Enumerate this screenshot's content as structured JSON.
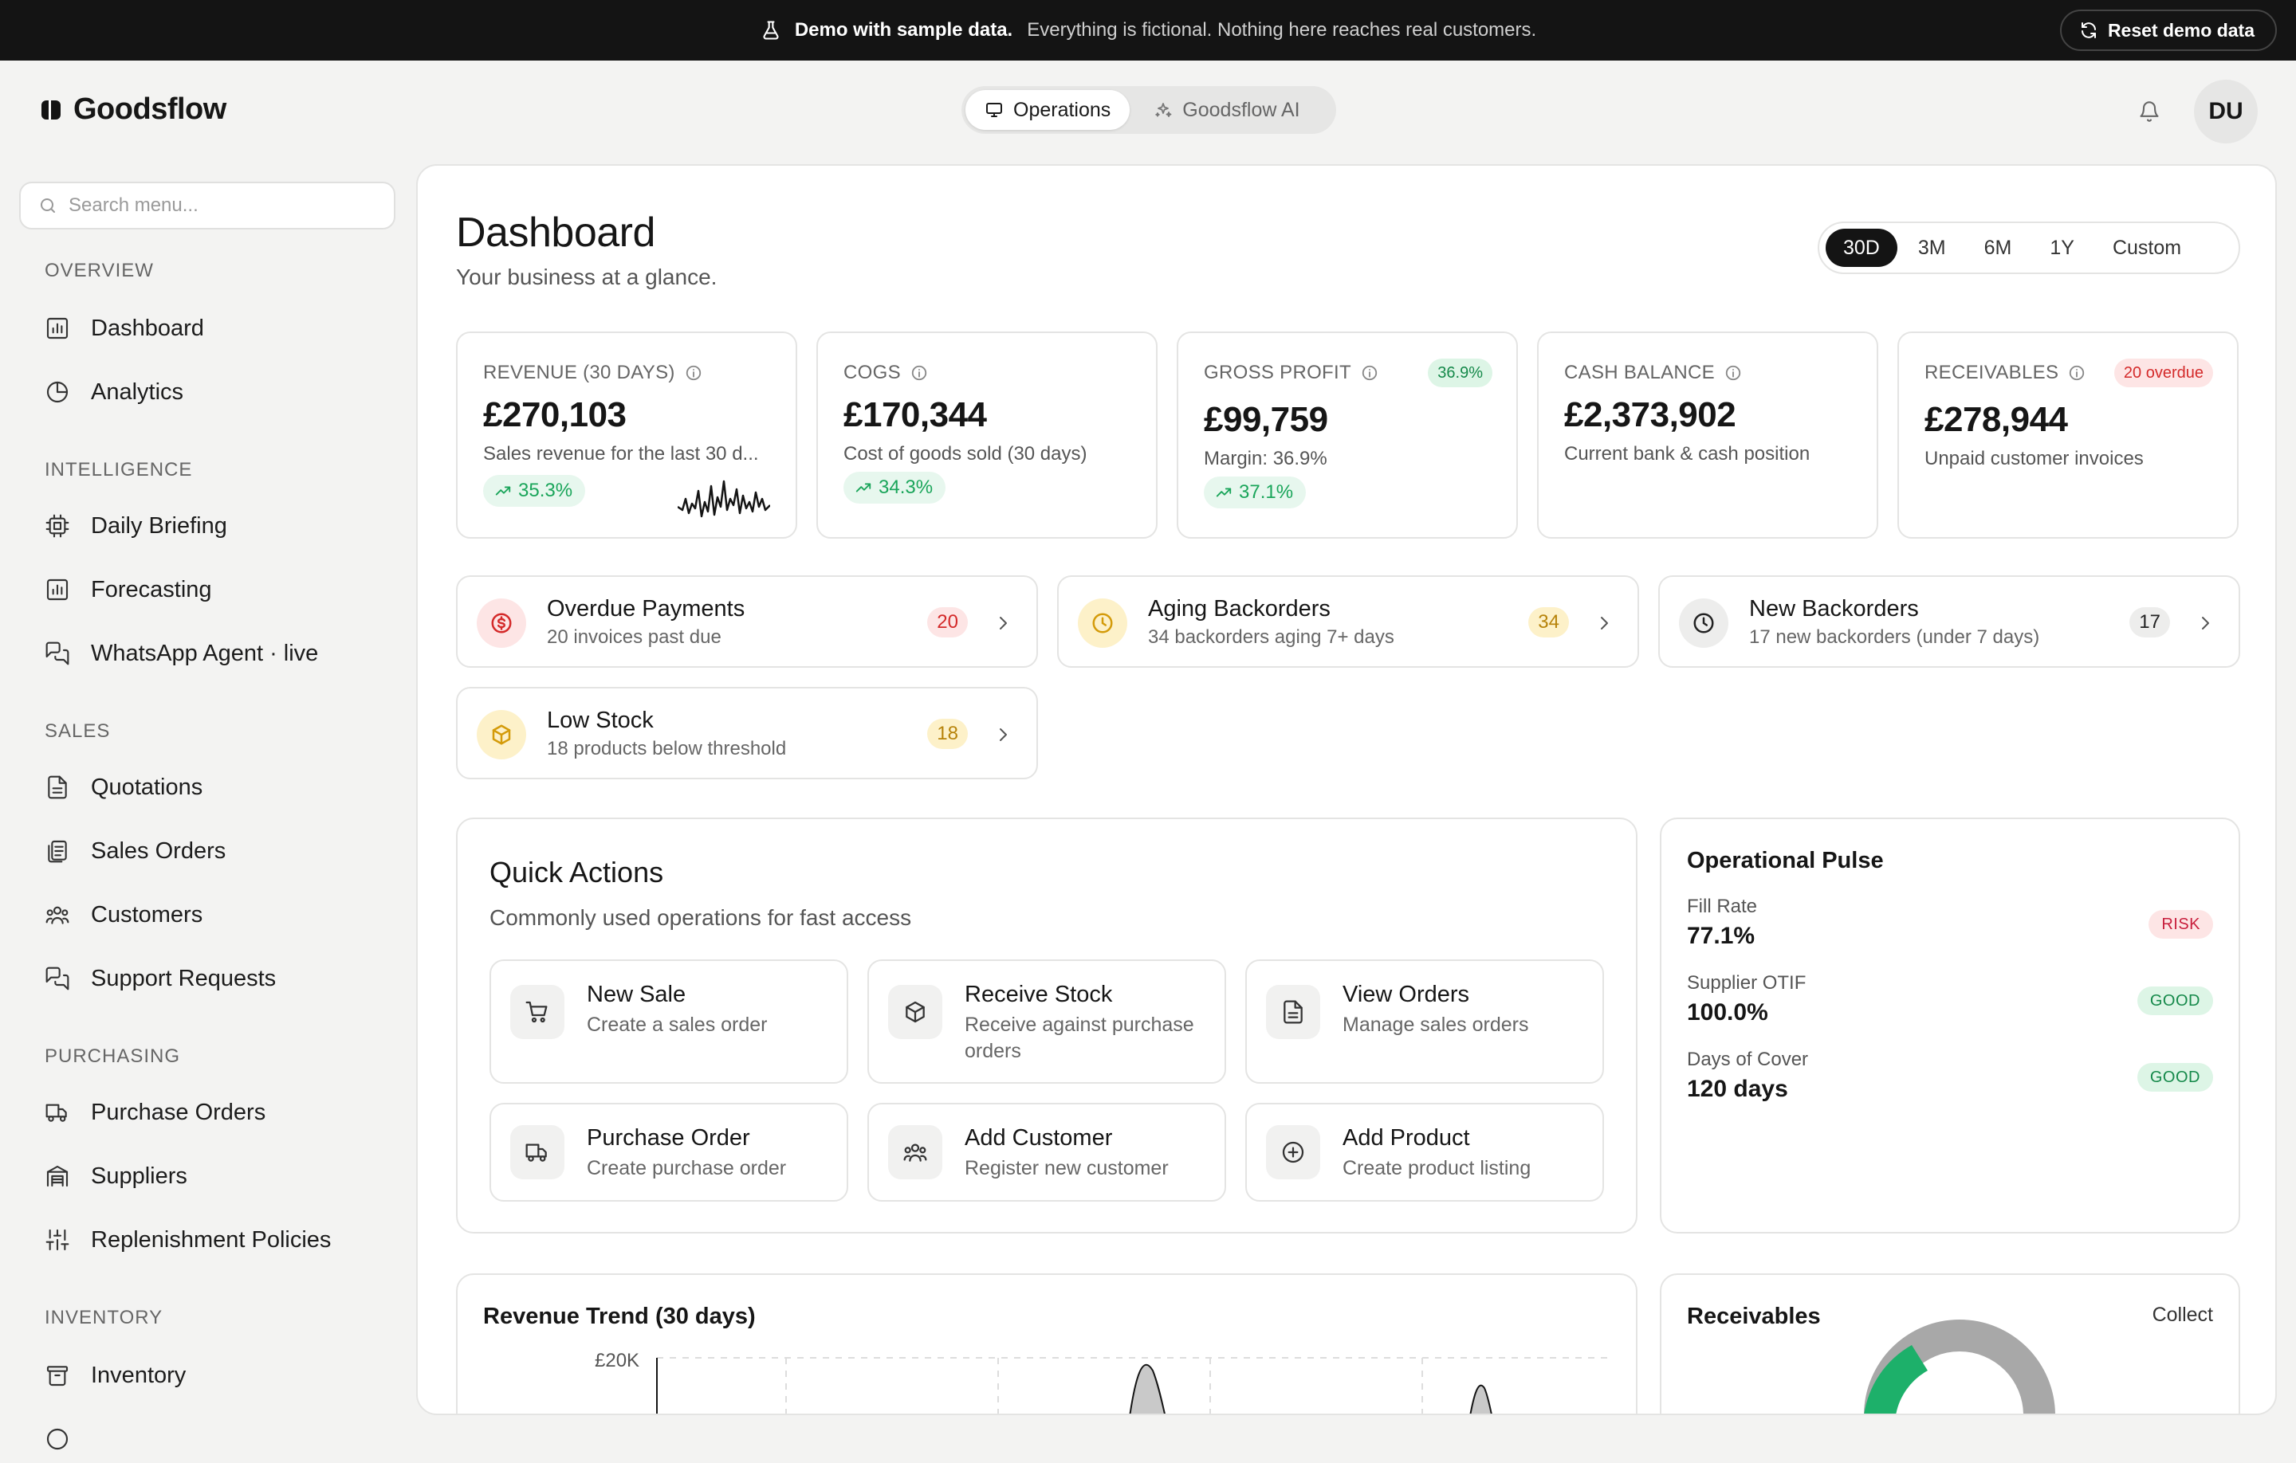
{
  "demo_banner": {
    "title": "Demo with sample data.",
    "message": "Everything is fictional. Nothing here reaches real customers.",
    "reset_label": "Reset demo data"
  },
  "brand": {
    "name": "Goodsflow"
  },
  "mode_switch": {
    "operations_label": "Operations",
    "ai_label": "Goodsflow AI"
  },
  "user": {
    "initials": "DU"
  },
  "sidebar": {
    "search_placeholder": "Search menu...",
    "sections": {
      "overview": "OVERVIEW",
      "intelligence": "INTELLIGENCE",
      "sales": "SALES",
      "purchasing": "PURCHASING",
      "inventory": "INVENTORY"
    },
    "items": {
      "dashboard": "Dashboard",
      "analytics": "Analytics",
      "daily_briefing": "Daily Briefing",
      "forecasting": "Forecasting",
      "whatsapp": "WhatsApp Agent · live",
      "quotations": "Quotations",
      "sales_orders": "Sales Orders",
      "customers": "Customers",
      "support": "Support Requests",
      "purchase_orders": "Purchase Orders",
      "suppliers": "Suppliers",
      "replenishment": "Replenishment Policies",
      "inventory": "Inventory"
    }
  },
  "page": {
    "title": "Dashboard",
    "subtitle": "Your business at a glance.",
    "ranges": [
      "30D",
      "3M",
      "6M",
      "1Y",
      "Custom"
    ],
    "active_range": "30D"
  },
  "kpis": {
    "revenue": {
      "label": "REVENUE (30 DAYS)",
      "value": "£270,103",
      "desc": "Sales revenue for the last 30 d...",
      "trend": "35.3%"
    },
    "cogs": {
      "label": "COGS",
      "value": "£170,344",
      "desc": "Cost of goods sold (30 days)",
      "trend": "34.3%"
    },
    "gross_profit": {
      "label": "GROSS PROFIT",
      "badge": "36.9%",
      "value": "£99,759",
      "desc": "Margin: 36.9%",
      "trend": "37.1%"
    },
    "cash": {
      "label": "CASH BALANCE",
      "value": "£2,373,902",
      "desc": "Current bank & cash position"
    },
    "receivables": {
      "label": "RECEIVABLES",
      "badge": "20 overdue",
      "value": "£278,944",
      "desc": "Unpaid customer invoices"
    }
  },
  "alerts": {
    "overdue": {
      "title": "Overdue Payments",
      "sub": "20 invoices past due",
      "count": "20"
    },
    "aging": {
      "title": "Aging Backorders",
      "sub": "34 backorders aging 7+ days",
      "count": "34"
    },
    "new_backorders": {
      "title": "New Backorders",
      "sub": "17 new backorders (under 7 days)",
      "count": "17"
    },
    "low_stock": {
      "title": "Low Stock",
      "sub": "18 products below threshold",
      "count": "18"
    }
  },
  "quick_actions": {
    "title": "Quick Actions",
    "subtitle": "Commonly used operations for fast access",
    "new_sale": {
      "title": "New Sale",
      "sub": "Create a sales order"
    },
    "receive_stock": {
      "title": "Receive Stock",
      "sub": "Receive against purchase orders"
    },
    "view_orders": {
      "title": "View Orders",
      "sub": "Manage sales orders"
    },
    "purchase_order": {
      "title": "Purchase Order",
      "sub": "Create purchase order"
    },
    "add_customer": {
      "title": "Add Customer",
      "sub": "Register new customer"
    },
    "add_product": {
      "title": "Add Product",
      "sub": "Create product listing"
    }
  },
  "pulse": {
    "title": "Operational Pulse",
    "fill_rate": {
      "label": "Fill Rate",
      "value": "77.1%",
      "status": "RISK"
    },
    "otif": {
      "label": "Supplier OTIF",
      "value": "100.0%",
      "status": "GOOD"
    },
    "cover": {
      "label": "Days of Cover",
      "value": "120 days",
      "status": "GOOD"
    }
  },
  "revenue_trend": {
    "title": "Revenue Trend (30 days)",
    "y_tick": "£20K"
  },
  "receivables_card": {
    "title": "Receivables",
    "action": "Collect"
  },
  "colors": {
    "accent_dark": "#141414",
    "positive": "#1aa55a",
    "danger": "#d42a2a",
    "warning": "#d49b0a"
  }
}
